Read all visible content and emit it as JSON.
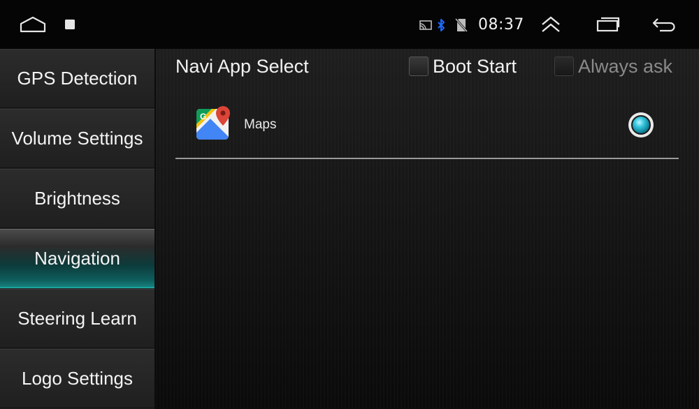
{
  "status_bar": {
    "time": "08:37",
    "icons": [
      "home-icon",
      "recent-square-icon",
      "cast-icon",
      "bluetooth-icon",
      "no-sim-icon",
      "expand-up-icon",
      "multitask-icon",
      "back-icon"
    ],
    "bluetooth_color": "#1e6bff"
  },
  "sidebar": {
    "items": [
      {
        "label": "GPS Detection",
        "active": false
      },
      {
        "label": "Volume Settings",
        "active": false
      },
      {
        "label": "Brightness",
        "active": false
      },
      {
        "label": "Navigation",
        "active": true
      },
      {
        "label": "Steering Learn",
        "active": false
      },
      {
        "label": "Logo Settings",
        "active": false
      }
    ],
    "accent_color": "#16807c"
  },
  "main": {
    "title": "Navi App Select",
    "boot_start": {
      "label": "Boot Start",
      "checked": false
    },
    "always_ask": {
      "label": "Always ask",
      "checked": false,
      "disabled": true
    },
    "apps": [
      {
        "name": "Maps",
        "icon": "google-maps-icon",
        "selected": true
      }
    ],
    "radio_color": "#39c9e0"
  }
}
